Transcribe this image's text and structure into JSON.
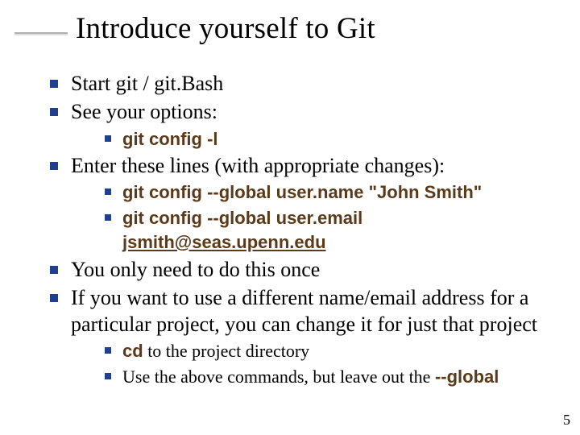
{
  "title": "Introduce yourself to Git",
  "items": [
    {
      "text": "Start git / git.Bash"
    },
    {
      "text": "See your options:",
      "sub": [
        {
          "code": "git config -l"
        }
      ]
    },
    {
      "text": "Enter these lines (with appropriate changes):",
      "sub": [
        {
          "code": "git config --global user.name \"John Smith\""
        },
        {
          "code_prefix": "git config --global user.email ",
          "code_link": "jsmith@seas.upenn.edu"
        }
      ]
    },
    {
      "text": "You only need to do this once"
    },
    {
      "text": "If you want to use a different name/email address for a particular project, you can change it for just that project",
      "sub": [
        {
          "code_prefix2": "cd",
          "tail": " to the project directory"
        },
        {
          "plain_prefix": "Use the above commands, but leave out the ",
          "code_suffix": "--global"
        }
      ]
    }
  ],
  "page_number": "5"
}
